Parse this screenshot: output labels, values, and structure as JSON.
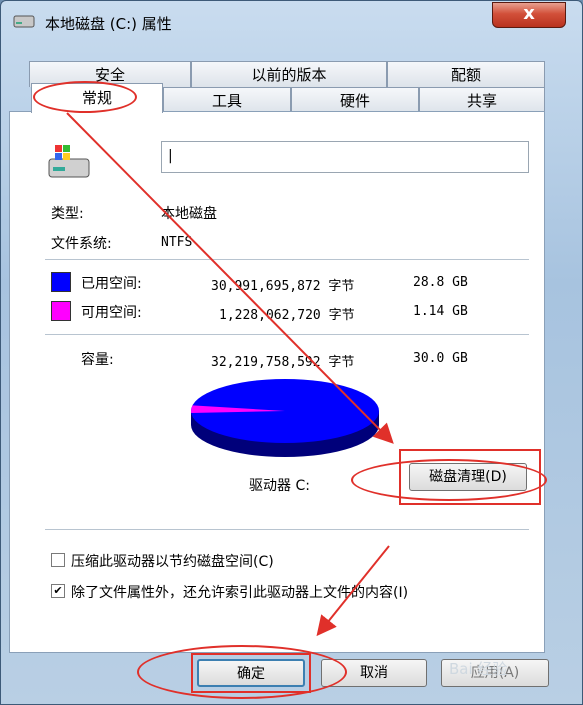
{
  "window": {
    "title": "本地磁盘 (C:) 属性",
    "close_label": "x",
    "colors": {
      "used": "#0000ff",
      "free": "#ff00ff",
      "annotation": "#e0302a"
    }
  },
  "tabs_top": [
    "安全",
    "以前的版本",
    "配额"
  ],
  "tabs_bottom": [
    "常规",
    "工具",
    "硬件",
    "共享"
  ],
  "general": {
    "name_value": "|",
    "type_label": "类型:",
    "type_value": "本地磁盘",
    "fs_label": "文件系统:",
    "fs_value": "NTFS",
    "used_label": "已用空间:",
    "used_bytes": "30,991,695,872 字节",
    "used_gb": "28.8 GB",
    "free_label": "可用空间:",
    "free_bytes": "1,228,062,720 字节",
    "free_gb": "1.14 GB",
    "cap_label": "容量:",
    "cap_bytes": "32,219,758,592 字节",
    "cap_gb": "30.0 GB",
    "drive_label": "驱动器 C:",
    "cleanup_button": "磁盘清理(D)",
    "used_fraction": 0.962,
    "compress_label": "压缩此驱动器以节约磁盘空间(C)",
    "compress_checked": false,
    "index_label": "除了文件属性外，还允许索引此驱动器上文件的内容(I)",
    "index_checked": true
  },
  "footer": {
    "ok": "确定",
    "cancel": "取消",
    "apply": "应用(A)",
    "watermark": "Bai 经验"
  }
}
